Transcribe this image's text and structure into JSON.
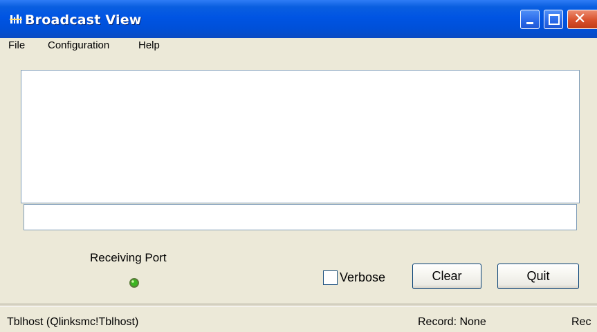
{
  "window": {
    "title": "Broadcast View"
  },
  "menu": [
    "File",
    "Configuration",
    "Help"
  ],
  "output": {
    "text": ""
  },
  "input": {
    "value": "",
    "placeholder": ""
  },
  "receiving_port": {
    "label": "Receiving Port",
    "status_color": "#3cb521"
  },
  "verbose": {
    "label": "Verbose",
    "checked": false
  },
  "buttons": {
    "clear": "Clear",
    "quit": "Quit"
  },
  "status": {
    "host": "Tblhost (Qlinksmc!Tblhost)",
    "record": "Record: None",
    "rec": "Rec"
  },
  "colors": {
    "titlebar": "#0054e3",
    "window_bg": "#ece9d8",
    "border": "#7f9db9"
  }
}
